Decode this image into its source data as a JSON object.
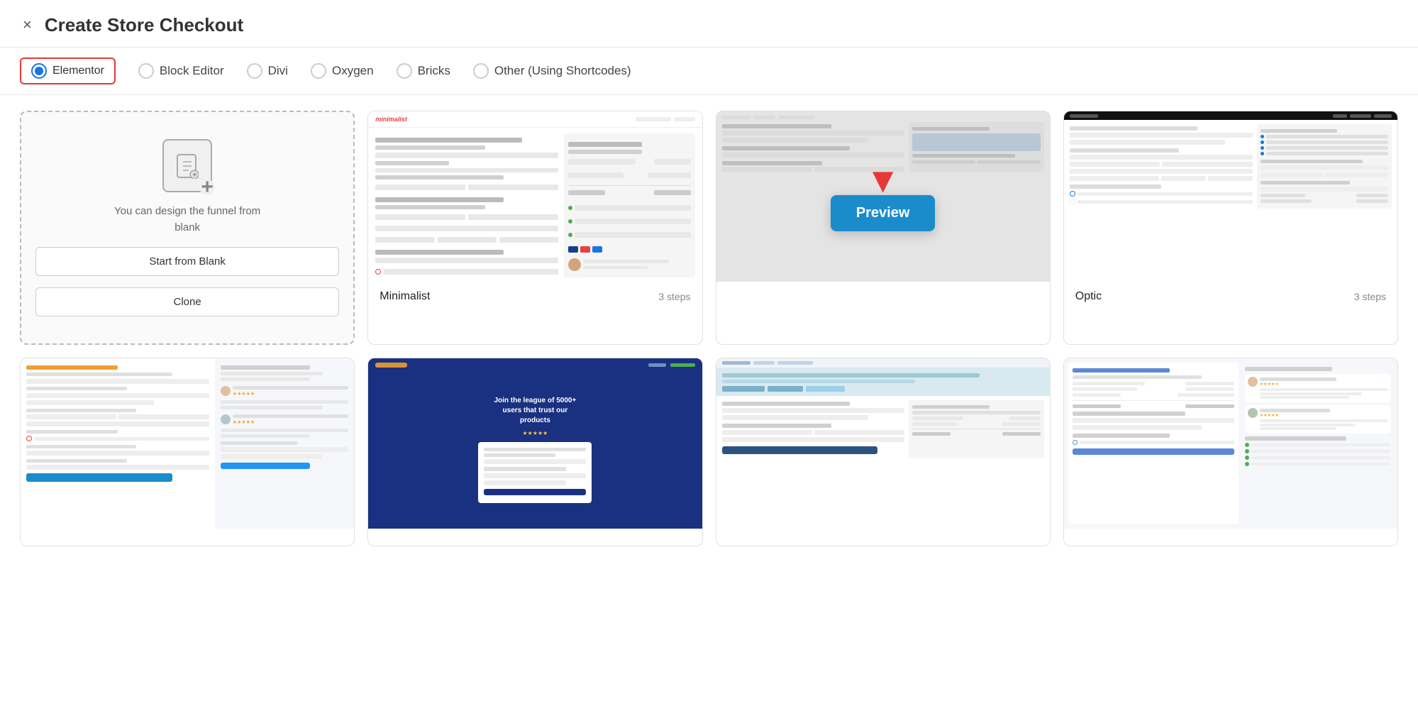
{
  "header": {
    "close_label": "×",
    "title": "Create Store Checkout"
  },
  "tabs": [
    {
      "id": "elementor",
      "label": "Elementor",
      "selected": true
    },
    {
      "id": "block-editor",
      "label": "Block Editor",
      "selected": false
    },
    {
      "id": "divi",
      "label": "Divi",
      "selected": false
    },
    {
      "id": "oxygen",
      "label": "Oxygen",
      "selected": false
    },
    {
      "id": "bricks",
      "label": "Bricks",
      "selected": false
    },
    {
      "id": "other",
      "label": "Other (Using Shortcodes)",
      "selected": false
    }
  ],
  "blank_card": {
    "text": "You can design the funnel from blank",
    "start_btn": "Start from Blank",
    "clone_btn": "Clone"
  },
  "templates": [
    {
      "id": "minimalist",
      "name": "Minimalist",
      "steps": "3 steps",
      "type": "minimalist"
    },
    {
      "id": "preview-hover",
      "name": "",
      "steps": "",
      "type": "preview-hover"
    },
    {
      "id": "optic",
      "name": "Optic",
      "steps": "3 steps",
      "type": "optic"
    },
    {
      "id": "logopsum-left",
      "name": "",
      "steps": "",
      "type": "logopsum-sm"
    },
    {
      "id": "logopsum-center",
      "name": "",
      "steps": "",
      "type": "logopsum-lg"
    },
    {
      "id": "utopia",
      "name": "",
      "steps": "",
      "type": "utopia"
    },
    {
      "id": "courselog",
      "name": "",
      "steps": "",
      "type": "courselog"
    }
  ],
  "preview_button": {
    "label": "Preview"
  }
}
